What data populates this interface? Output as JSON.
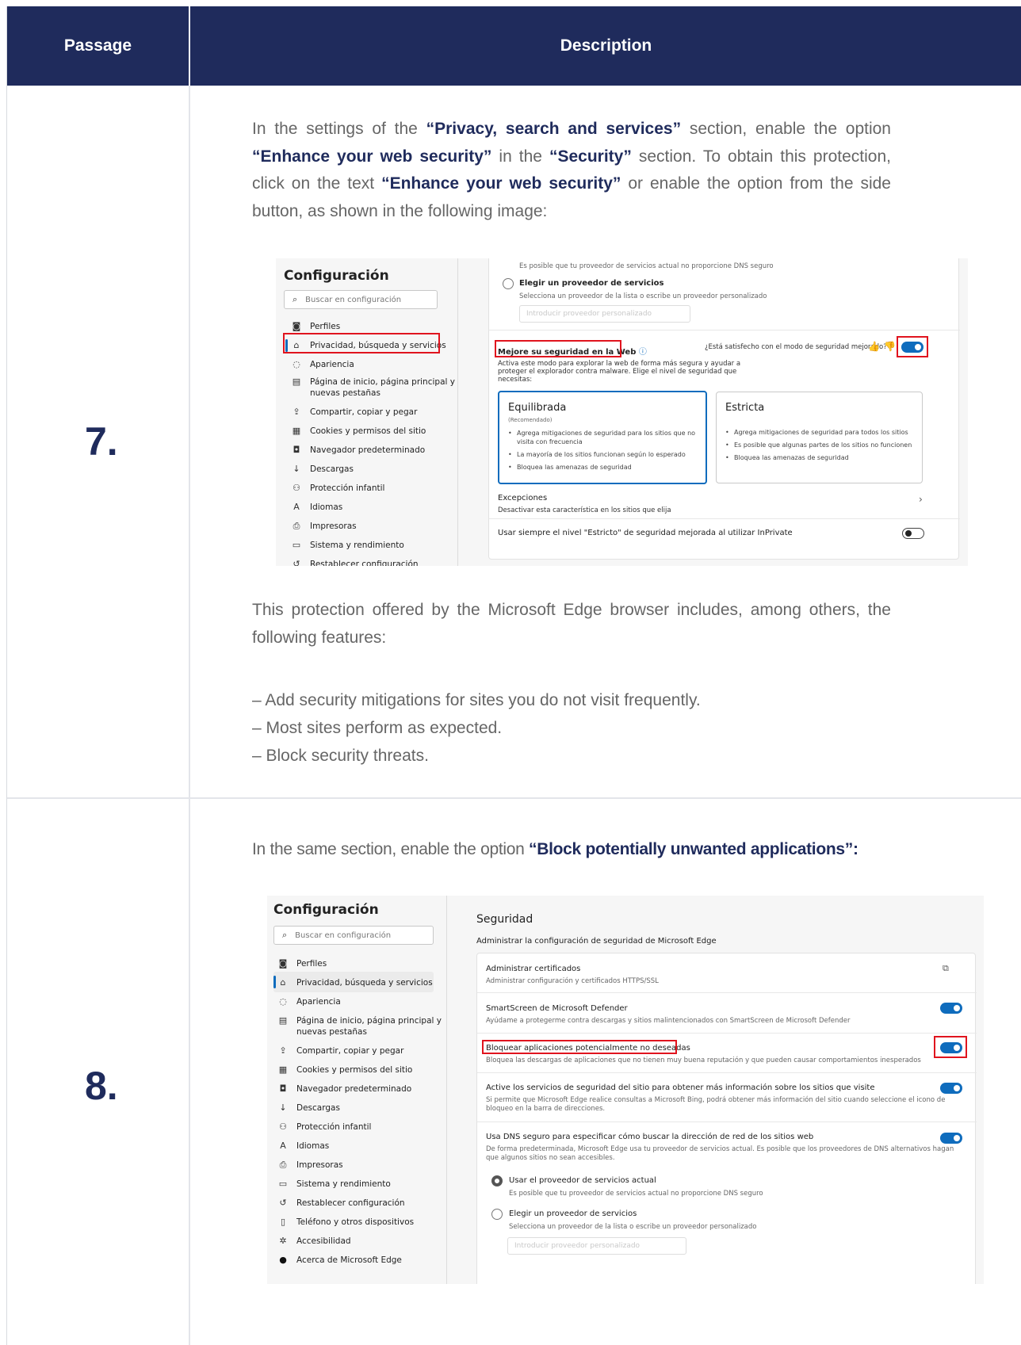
{
  "header": {
    "col1": "Passage",
    "col2": "Description"
  },
  "rows": [
    {
      "number": "7.",
      "intro_segments": [
        "In the settings of the ",
        "“Privacy, search and services”",
        " section, enable the option ",
        "“Enhance your web security”",
        " in the ",
        "“Security”",
        " section. To obtain this protection, click on the text ",
        "“Enhance your web security”",
        " or enable the option from the side button, as shown in the following image:"
      ],
      "follow": "This protection offered by the Microsoft Edge browser includes, among others, the following features:",
      "features": [
        "– Add security mitigations for sites you do not visit frequently.",
        "– Most sites perform as expected.",
        "– Block security threats."
      ]
    },
    {
      "number": "8.",
      "intro_segments": [
        "In the same section, enable the option ",
        "“Block potentially unwanted applications”:"
      ]
    }
  ],
  "shot1": {
    "title": "Configuración",
    "search_placeholder": "Buscar en configuración",
    "nav": [
      "Perfiles",
      "Privacidad, búsqueda y servicios",
      "Apariencia",
      "Página de inicio, página principal y",
      "nuevas pestañas",
      "Compartir, copiar y pegar",
      "Cookies y permisos del sitio",
      "Navegador predeterminado",
      "Descargas",
      "Protección infantil",
      "Idiomas",
      "Impresoras",
      "Sistema y rendimiento",
      "Restablecer configuración"
    ],
    "dns_note": "Es posible que tu proveedor de servicios actual no proporcione DNS seguro",
    "provider_title": "Elegir un proveedor de servicios",
    "provider_desc": "Selecciona un proveedor de la lista o escribe un proveedor personalizado",
    "provider_placeholder": "Introducir proveedor personalizado",
    "security_title": "Mejore su seguridad en la Web",
    "feedback_q": "¿Está satisfecho con el modo de seguridad mejorado?",
    "security_desc": [
      "Activa este modo para explorar la web de forma más segura y ayudar a",
      "proteger el explorador contra malware. Elige el nivel de seguridad que",
      "necesitas:"
    ],
    "balanced": {
      "title": "Equilibrada",
      "tag": "(Recomendado)",
      "items": [
        "Agrega mitigaciones de seguridad para los sitios que no visita con frecuencia",
        "La mayoría de los sitios funcionan según lo esperado",
        "Bloquea las amenazas de seguridad"
      ]
    },
    "strict": {
      "title": "Estricta",
      "items": [
        "Agrega mitigaciones de seguridad para todos los sitios",
        "Es posible que algunas partes de los sitios no funcionen",
        "Bloquea las amenazas de seguridad"
      ]
    },
    "exceptions_title": "Excepciones",
    "exceptions_desc": "Desactivar esta característica en los sitios que elija",
    "inprivate": "Usar siempre el nivel \"Estricto\" de seguridad mejorada al utilizar InPrivate"
  },
  "shot2": {
    "title": "Configuración",
    "search_placeholder": "Buscar en configuración",
    "nav": [
      "Perfiles",
      "Privacidad, búsqueda y servicios",
      "Apariencia",
      "Página de inicio, página principal y",
      "nuevas pestañas",
      "Compartir, copiar y pegar",
      "Cookies y permisos del sitio",
      "Navegador predeterminado",
      "Descargas",
      "Protección infantil",
      "Idiomas",
      "Impresoras",
      "Sistema y rendimiento",
      "Restablecer configuración",
      "Teléfono y otros dispositivos",
      "Accesibilidad",
      "Acerca de Microsoft Edge"
    ],
    "section_title": "Seguridad",
    "section_desc": "Administrar la configuración de seguridad de Microsoft Edge",
    "certs_title": "Administrar certificados",
    "certs_desc": "Administrar configuración y certificados HTTPS/SSL",
    "smartscreen_title": "SmartScreen de Microsoft Defender",
    "smartscreen_desc": "Ayúdame a protegerme contra descargas y sitios malintencionados con SmartScreen de Microsoft Defender",
    "pua_title": "Bloquear aplicaciones potencialmente no deseadas",
    "pua_desc": "Bloquea las descargas de aplicaciones que no tienen muy buena reputación y que pueden causar comportamientos inesperados",
    "siteinfo_title": "Active los servicios de seguridad del sitio para obtener más información sobre los sitios que visite",
    "siteinfo_desc": [
      "Si permite que Microsoft Edge realice consultas a Microsoft Bing, podrá obtener más información del sitio cuando seleccione el icono de",
      "bloqueo en la barra de direcciones."
    ],
    "dns_title": "Usa DNS seguro para especificar cómo buscar la dirección de red de los sitios web",
    "dns_desc": [
      "De forma predeterminada, Microsoft Edge usa tu proveedor de servicios actual. Es posible que los proveedores de DNS alternativos hagan",
      "que algunos sitios no sean accesibles."
    ],
    "current_title": "Usar el proveedor de servicios actual",
    "current_desc": "Es posible que tu proveedor de servicios actual no proporcione DNS seguro",
    "provider_title": "Elegir un proveedor de servicios",
    "provider_desc": "Selecciona un proveedor de la lista o escribe un proveedor personalizado",
    "provider_placeholder": "Introducir proveedor personalizado"
  }
}
